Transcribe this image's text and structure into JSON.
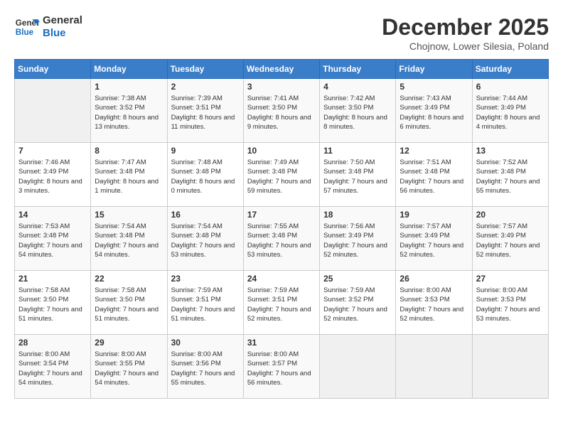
{
  "logo": {
    "line1": "General",
    "line2": "Blue"
  },
  "title": "December 2025",
  "subtitle": "Chojnow, Lower Silesia, Poland",
  "weekdays": [
    "Sunday",
    "Monday",
    "Tuesday",
    "Wednesday",
    "Thursday",
    "Friday",
    "Saturday"
  ],
  "weeks": [
    [
      {
        "day": "",
        "sunrise": "",
        "sunset": "",
        "daylight": ""
      },
      {
        "day": "1",
        "sunrise": "Sunrise: 7:38 AM",
        "sunset": "Sunset: 3:52 PM",
        "daylight": "Daylight: 8 hours and 13 minutes."
      },
      {
        "day": "2",
        "sunrise": "Sunrise: 7:39 AM",
        "sunset": "Sunset: 3:51 PM",
        "daylight": "Daylight: 8 hours and 11 minutes."
      },
      {
        "day": "3",
        "sunrise": "Sunrise: 7:41 AM",
        "sunset": "Sunset: 3:50 PM",
        "daylight": "Daylight: 8 hours and 9 minutes."
      },
      {
        "day": "4",
        "sunrise": "Sunrise: 7:42 AM",
        "sunset": "Sunset: 3:50 PM",
        "daylight": "Daylight: 8 hours and 8 minutes."
      },
      {
        "day": "5",
        "sunrise": "Sunrise: 7:43 AM",
        "sunset": "Sunset: 3:49 PM",
        "daylight": "Daylight: 8 hours and 6 minutes."
      },
      {
        "day": "6",
        "sunrise": "Sunrise: 7:44 AM",
        "sunset": "Sunset: 3:49 PM",
        "daylight": "Daylight: 8 hours and 4 minutes."
      }
    ],
    [
      {
        "day": "7",
        "sunrise": "Sunrise: 7:46 AM",
        "sunset": "Sunset: 3:49 PM",
        "daylight": "Daylight: 8 hours and 3 minutes."
      },
      {
        "day": "8",
        "sunrise": "Sunrise: 7:47 AM",
        "sunset": "Sunset: 3:48 PM",
        "daylight": "Daylight: 8 hours and 1 minute."
      },
      {
        "day": "9",
        "sunrise": "Sunrise: 7:48 AM",
        "sunset": "Sunset: 3:48 PM",
        "daylight": "Daylight: 8 hours and 0 minutes."
      },
      {
        "day": "10",
        "sunrise": "Sunrise: 7:49 AM",
        "sunset": "Sunset: 3:48 PM",
        "daylight": "Daylight: 7 hours and 59 minutes."
      },
      {
        "day": "11",
        "sunrise": "Sunrise: 7:50 AM",
        "sunset": "Sunset: 3:48 PM",
        "daylight": "Daylight: 7 hours and 57 minutes."
      },
      {
        "day": "12",
        "sunrise": "Sunrise: 7:51 AM",
        "sunset": "Sunset: 3:48 PM",
        "daylight": "Daylight: 7 hours and 56 minutes."
      },
      {
        "day": "13",
        "sunrise": "Sunrise: 7:52 AM",
        "sunset": "Sunset: 3:48 PM",
        "daylight": "Daylight: 7 hours and 55 minutes."
      }
    ],
    [
      {
        "day": "14",
        "sunrise": "Sunrise: 7:53 AM",
        "sunset": "Sunset: 3:48 PM",
        "daylight": "Daylight: 7 hours and 54 minutes."
      },
      {
        "day": "15",
        "sunrise": "Sunrise: 7:54 AM",
        "sunset": "Sunset: 3:48 PM",
        "daylight": "Daylight: 7 hours and 54 minutes."
      },
      {
        "day": "16",
        "sunrise": "Sunrise: 7:54 AM",
        "sunset": "Sunset: 3:48 PM",
        "daylight": "Daylight: 7 hours and 53 minutes."
      },
      {
        "day": "17",
        "sunrise": "Sunrise: 7:55 AM",
        "sunset": "Sunset: 3:48 PM",
        "daylight": "Daylight: 7 hours and 53 minutes."
      },
      {
        "day": "18",
        "sunrise": "Sunrise: 7:56 AM",
        "sunset": "Sunset: 3:49 PM",
        "daylight": "Daylight: 7 hours and 52 minutes."
      },
      {
        "day": "19",
        "sunrise": "Sunrise: 7:57 AM",
        "sunset": "Sunset: 3:49 PM",
        "daylight": "Daylight: 7 hours and 52 minutes."
      },
      {
        "day": "20",
        "sunrise": "Sunrise: 7:57 AM",
        "sunset": "Sunset: 3:49 PM",
        "daylight": "Daylight: 7 hours and 52 minutes."
      }
    ],
    [
      {
        "day": "21",
        "sunrise": "Sunrise: 7:58 AM",
        "sunset": "Sunset: 3:50 PM",
        "daylight": "Daylight: 7 hours and 51 minutes."
      },
      {
        "day": "22",
        "sunrise": "Sunrise: 7:58 AM",
        "sunset": "Sunset: 3:50 PM",
        "daylight": "Daylight: 7 hours and 51 minutes."
      },
      {
        "day": "23",
        "sunrise": "Sunrise: 7:59 AM",
        "sunset": "Sunset: 3:51 PM",
        "daylight": "Daylight: 7 hours and 51 minutes."
      },
      {
        "day": "24",
        "sunrise": "Sunrise: 7:59 AM",
        "sunset": "Sunset: 3:51 PM",
        "daylight": "Daylight: 7 hours and 52 minutes."
      },
      {
        "day": "25",
        "sunrise": "Sunrise: 7:59 AM",
        "sunset": "Sunset: 3:52 PM",
        "daylight": "Daylight: 7 hours and 52 minutes."
      },
      {
        "day": "26",
        "sunrise": "Sunrise: 8:00 AM",
        "sunset": "Sunset: 3:53 PM",
        "daylight": "Daylight: 7 hours and 52 minutes."
      },
      {
        "day": "27",
        "sunrise": "Sunrise: 8:00 AM",
        "sunset": "Sunset: 3:53 PM",
        "daylight": "Daylight: 7 hours and 53 minutes."
      }
    ],
    [
      {
        "day": "28",
        "sunrise": "Sunrise: 8:00 AM",
        "sunset": "Sunset: 3:54 PM",
        "daylight": "Daylight: 7 hours and 54 minutes."
      },
      {
        "day": "29",
        "sunrise": "Sunrise: 8:00 AM",
        "sunset": "Sunset: 3:55 PM",
        "daylight": "Daylight: 7 hours and 54 minutes."
      },
      {
        "day": "30",
        "sunrise": "Sunrise: 8:00 AM",
        "sunset": "Sunset: 3:56 PM",
        "daylight": "Daylight: 7 hours and 55 minutes."
      },
      {
        "day": "31",
        "sunrise": "Sunrise: 8:00 AM",
        "sunset": "Sunset: 3:57 PM",
        "daylight": "Daylight: 7 hours and 56 minutes."
      },
      {
        "day": "",
        "sunrise": "",
        "sunset": "",
        "daylight": ""
      },
      {
        "day": "",
        "sunrise": "",
        "sunset": "",
        "daylight": ""
      },
      {
        "day": "",
        "sunrise": "",
        "sunset": "",
        "daylight": ""
      }
    ]
  ]
}
